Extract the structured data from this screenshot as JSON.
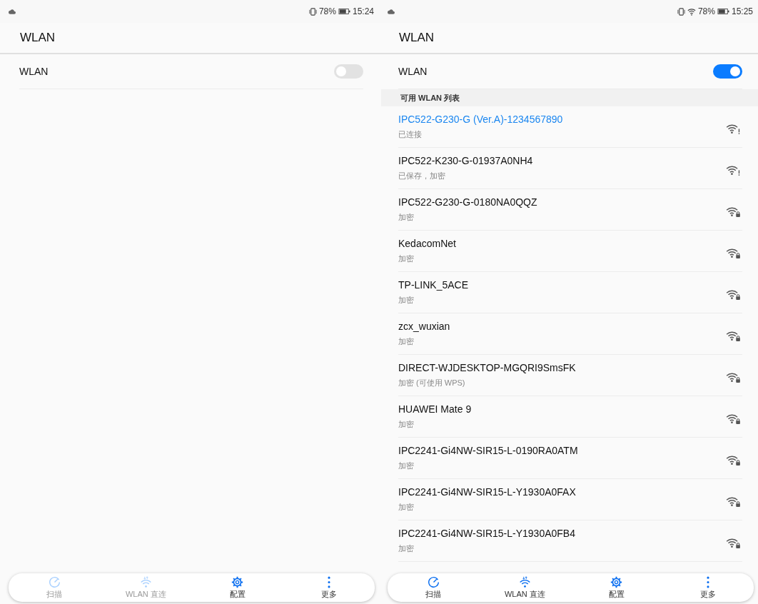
{
  "screens": [
    {
      "status_bar": {
        "wifi": false,
        "battery": "78%",
        "time": "15:24"
      },
      "title": "WLAN",
      "wlan_switch": {
        "label": "WLAN",
        "on": false
      },
      "bottom_bar": [
        {
          "kind": "scan",
          "label": "扫描",
          "disabled": true
        },
        {
          "kind": "direct",
          "label": "WLAN 直连",
          "disabled": true
        },
        {
          "kind": "settings",
          "label": "配置",
          "disabled": false
        },
        {
          "kind": "more",
          "label": "更多",
          "disabled": false
        }
      ]
    },
    {
      "status_bar": {
        "wifi": true,
        "battery": "78%",
        "time": "15:25"
      },
      "title": "WLAN",
      "wlan_switch": {
        "label": "WLAN",
        "on": true
      },
      "section_header": "可用 WLAN 列表",
      "networks": [
        {
          "name": "IPC522-G230-G (Ver.A)-1234567890",
          "status": "已连接",
          "connected": true,
          "locked": false
        },
        {
          "name": "IPC522-K230-G-01937A0NH4",
          "status": "已保存，加密",
          "connected": false,
          "locked": false
        },
        {
          "name": "IPC522-G230-G-0180NA0QQZ",
          "status": "加密",
          "connected": false,
          "locked": true
        },
        {
          "name": "KedacomNet",
          "status": "加密",
          "connected": false,
          "locked": true
        },
        {
          "name": "TP-LINK_5ACE",
          "status": "加密",
          "connected": false,
          "locked": true
        },
        {
          "name": "zcx_wuxian",
          "status": "加密",
          "connected": false,
          "locked": true
        },
        {
          "name": "DIRECT-WJDESKTOP-MGQRI9SmsFK",
          "status": "加密 (可使用 WPS)",
          "connected": false,
          "locked": true
        },
        {
          "name": "HUAWEI Mate 9",
          "status": "加密",
          "connected": false,
          "locked": true
        },
        {
          "name": "IPC2241-Gi4NW-SIR15-L-0190RA0ATM",
          "status": "加密",
          "connected": false,
          "locked": true
        },
        {
          "name": "IPC2241-Gi4NW-SIR15-L-Y1930A0FAX",
          "status": "加密",
          "connected": false,
          "locked": true
        },
        {
          "name": "IPC2241-Gi4NW-SIR15-L-Y1930A0FB4",
          "status": "加密",
          "connected": false,
          "locked": true
        }
      ],
      "bottom_bar": [
        {
          "kind": "scan",
          "label": "扫描",
          "disabled": false
        },
        {
          "kind": "direct",
          "label": "WLAN 直连",
          "disabled": false
        },
        {
          "kind": "settings",
          "label": "配置",
          "disabled": false
        },
        {
          "kind": "more",
          "label": "更多",
          "disabled": false
        }
      ]
    }
  ]
}
